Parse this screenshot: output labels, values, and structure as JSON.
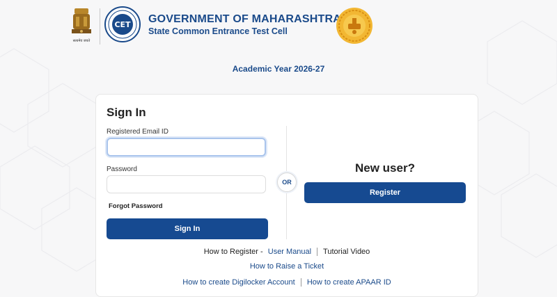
{
  "header": {
    "emblem_caption": "सत्यमेव जयते",
    "logo_text": "CET",
    "title": "GOVERNMENT OF MAHARASHTRA",
    "subtitle": "State Common Entrance Test Cell"
  },
  "academic_year": "Academic Year 2026-27",
  "signin": {
    "title": "Sign In",
    "email_label": "Registered Email ID",
    "email_value": "",
    "password_label": "Password",
    "password_value": "",
    "forgot": "Forgot Password",
    "button": "Sign In"
  },
  "divider": {
    "or": "OR"
  },
  "register": {
    "heading": "New user?",
    "button": "Register"
  },
  "help_links": {
    "how_to_register": "How to Register -",
    "user_manual": "User Manual",
    "tutorial_video": "Tutorial Video",
    "raise_ticket": "How to Raise a Ticket",
    "digilocker": "How to create Digilocker Account",
    "apaar": "How to create APAAR ID"
  },
  "colors": {
    "primary": "#164a91",
    "heading_blue": "#1a4a8a",
    "focus_border": "#a9c4ec"
  }
}
